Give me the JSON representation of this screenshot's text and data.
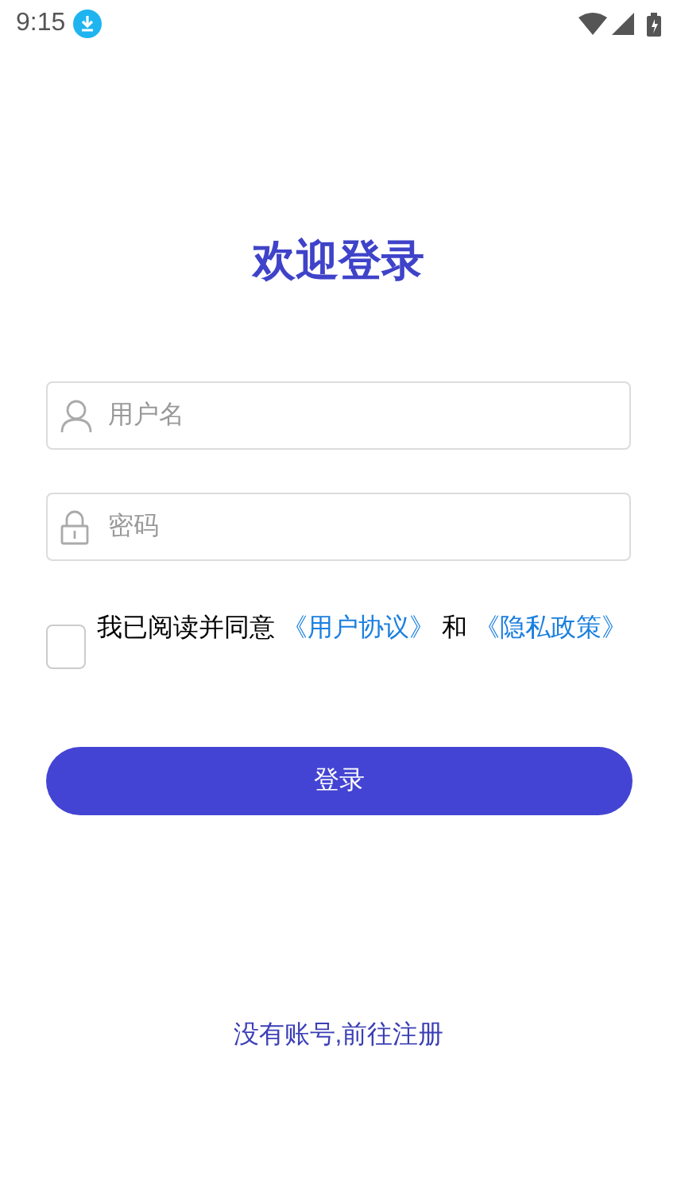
{
  "status_bar": {
    "time": "9:15"
  },
  "title": "欢迎登录",
  "fields": [
    {
      "kind": "user",
      "placeholder": "用户名"
    },
    {
      "kind": "lock",
      "placeholder": "密码"
    }
  ],
  "agreement": {
    "checked": false,
    "parts": [
      {
        "kind": "text",
        "text": "我已阅读并同意"
      },
      {
        "kind": "link",
        "text": "《用户协议》"
      },
      {
        "kind": "text",
        "text": "和"
      },
      {
        "kind": "link",
        "text": "《隐私政策》"
      }
    ]
  },
  "login_button": "登录",
  "register_link": "没有账号,前往注册"
}
